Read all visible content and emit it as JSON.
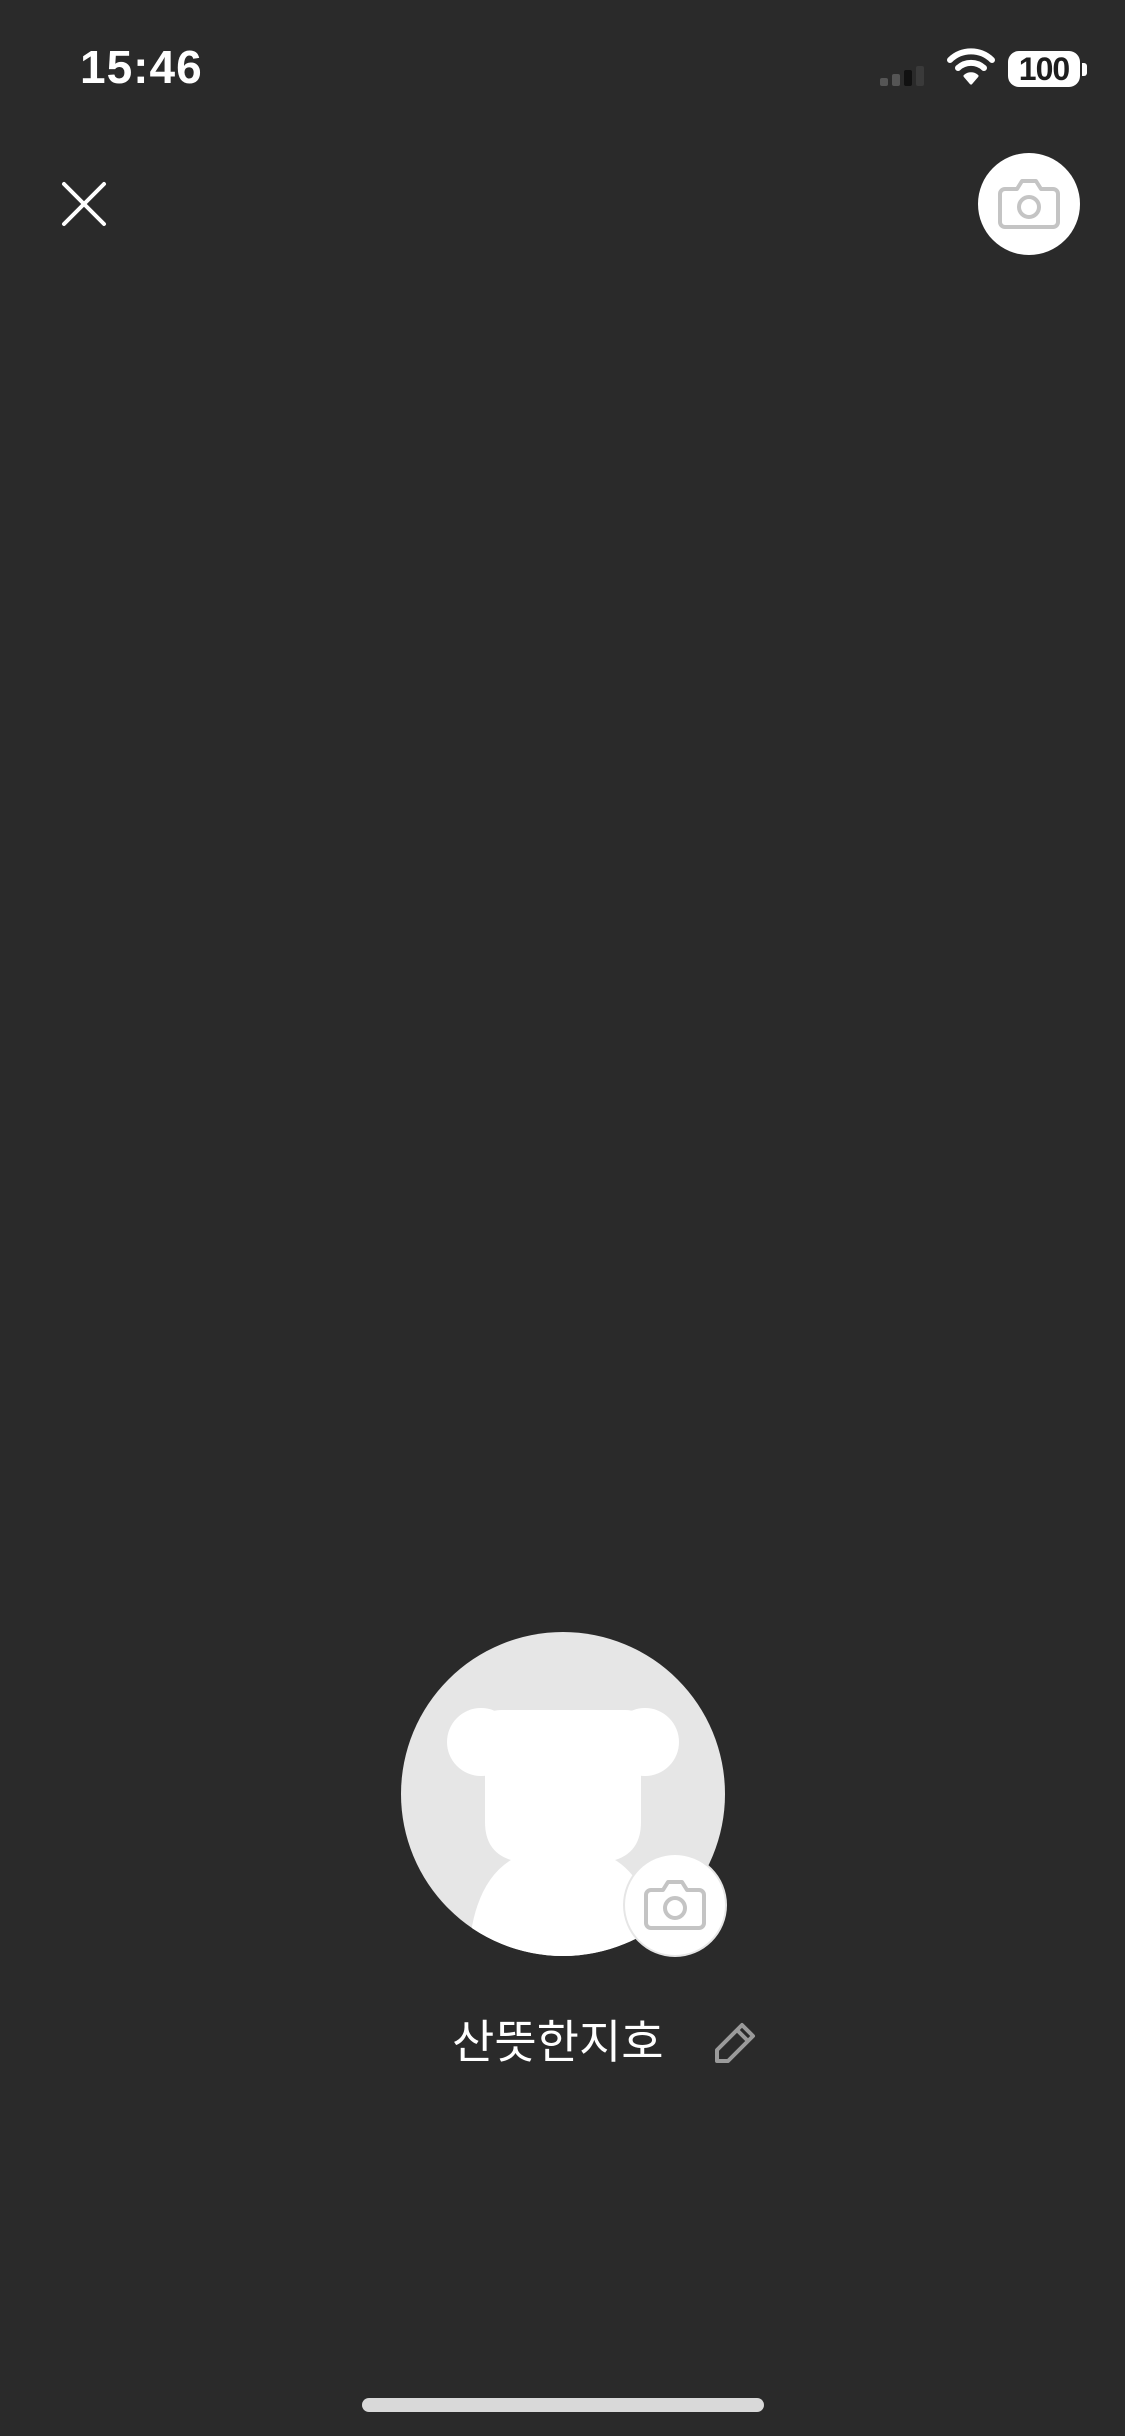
{
  "status_bar": {
    "time": "15:46",
    "battery": "100"
  },
  "controls": {
    "close_icon": "close-icon",
    "background_camera_icon": "camera-icon"
  },
  "profile": {
    "name": "산뜻한지호",
    "avatar_icon": "bear-silhouette-icon",
    "photo_camera_icon": "camera-icon",
    "edit_icon": "pencil-icon"
  },
  "colors": {
    "background": "#2a2a2a",
    "avatar_bg": "#e6e6e6",
    "icon_gray": "#c4c4c4",
    "text": "#ffffff"
  }
}
